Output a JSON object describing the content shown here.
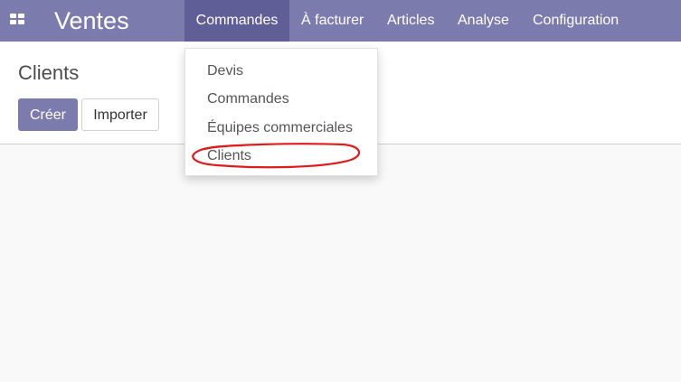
{
  "app": {
    "title": "Ventes",
    "apps_icon": "grid-icon"
  },
  "nav": {
    "items": [
      {
        "label": "Commandes",
        "active": true
      },
      {
        "label": "À facturer"
      },
      {
        "label": "Articles"
      },
      {
        "label": "Analyse"
      },
      {
        "label": "Configuration"
      }
    ]
  },
  "dropdown": {
    "items": [
      {
        "label": "Devis"
      },
      {
        "label": "Commandes"
      },
      {
        "label": "Équipes commerciales"
      },
      {
        "label": "Clients",
        "highlighted": true
      }
    ]
  },
  "control_panel": {
    "breadcrumb": "Clients",
    "create_label": "Créer",
    "import_label": "Importer"
  },
  "colors": {
    "navbar": "#7c7bad",
    "nav_active": "#5f5e97",
    "primary_button": "#7c7bad",
    "annotation": "#e11b1b"
  }
}
